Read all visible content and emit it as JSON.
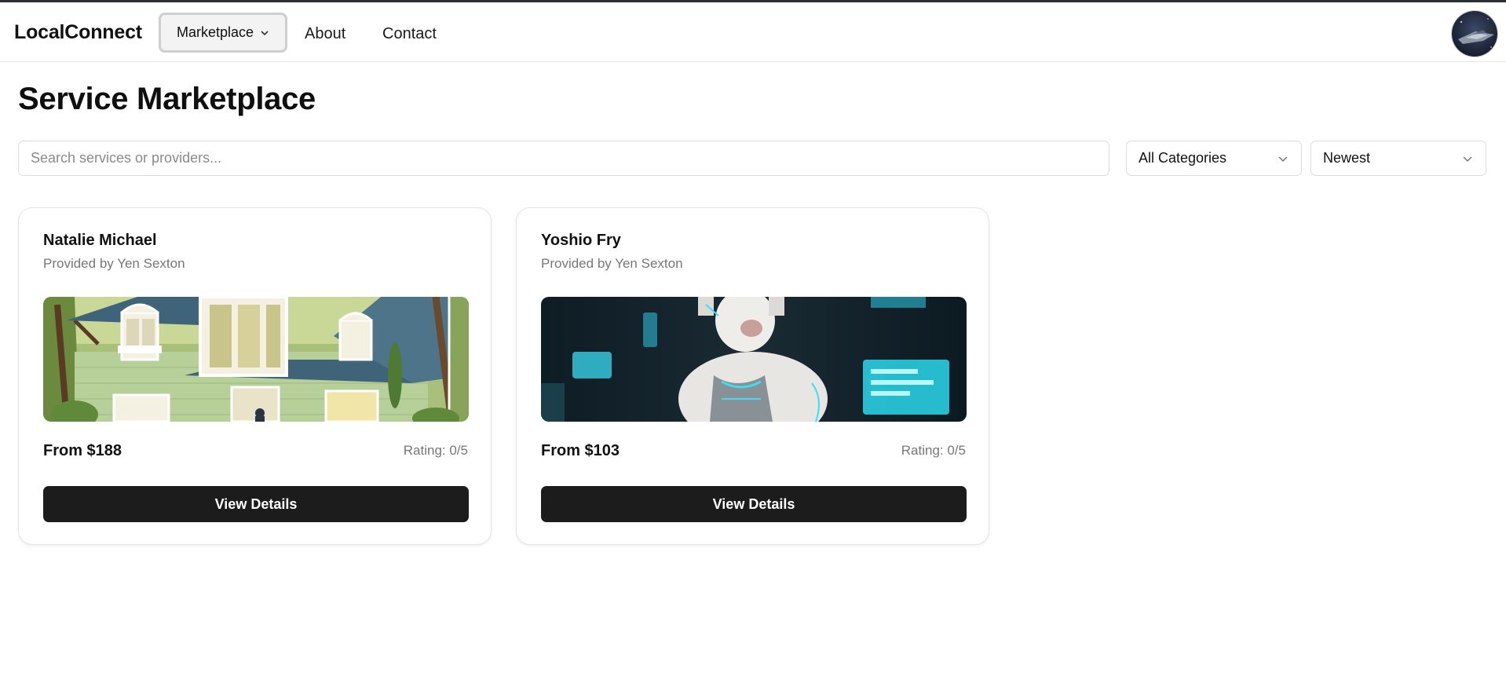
{
  "nav": {
    "brand": "LocalConnect",
    "marketplace_label": "Marketplace",
    "about_label": "About",
    "contact_label": "Contact"
  },
  "page": {
    "title": "Service Marketplace"
  },
  "filters": {
    "search_placeholder": "Search services or providers...",
    "search_value": "",
    "category_selected": "All Categories",
    "sort_selected": "Newest"
  },
  "listings": [
    {
      "title": "Natalie Michael",
      "provider": "Provided by Yen Sexton",
      "price": "From $188",
      "rating": "Rating: 0/5",
      "button_label": "View Details",
      "image_icon": "house-illustration-image"
    },
    {
      "title": "Yoshio Fry",
      "provider": "Provided by Yen Sexton",
      "price": "From $103",
      "rating": "Rating: 0/5",
      "button_label": "View Details",
      "image_icon": "cyber-llama-image"
    }
  ],
  "colors": {
    "primary_button": "#1c1c1c",
    "muted_text": "#777777",
    "border": "#dcdcdc"
  }
}
